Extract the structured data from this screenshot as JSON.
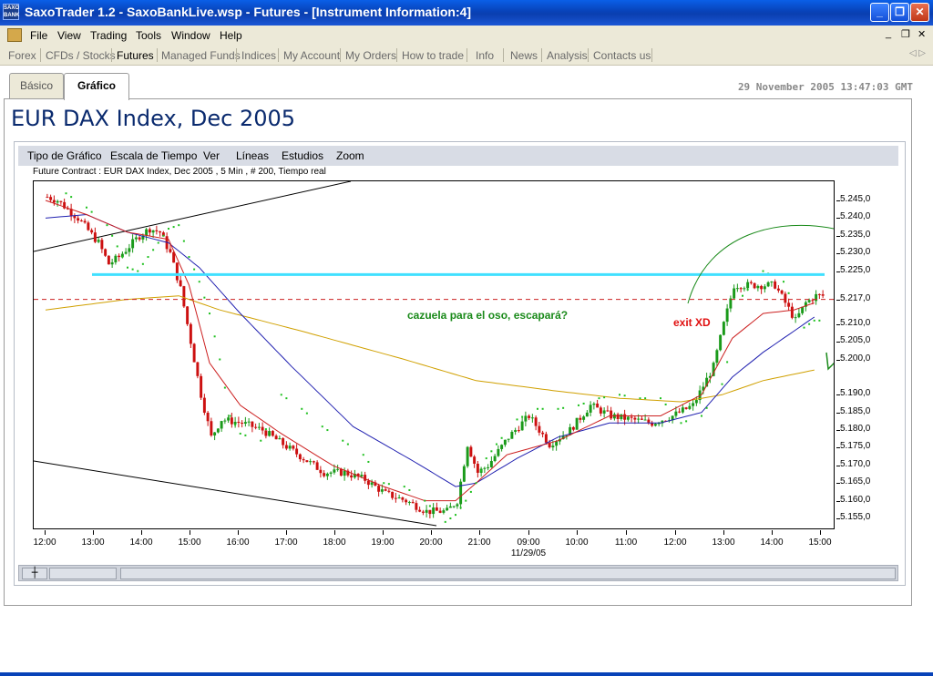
{
  "window": {
    "icon_text": "SAXO BANK",
    "title": "SaxoTrader 1.2 - SaxoBankLive.wsp - Futures - [Instrument Information:4]",
    "minimize": "_",
    "maximize": "❐",
    "close": "✕"
  },
  "menubar": {
    "items": [
      "File",
      "View",
      "Trading",
      "Tools",
      "Window",
      "Help"
    ],
    "mdi_min": "_",
    "mdi_restore": "❐",
    "mdi_close": "✕"
  },
  "nav": {
    "tabs": [
      "Forex",
      "CFDs / Stocks",
      "Futures",
      "Managed Funds",
      "Indices",
      "My Account",
      "My Orders",
      "How to trade",
      "Info",
      "News",
      "Analysis",
      "Contacts us"
    ],
    "active": "Futures",
    "scroll": "◁ ▷"
  },
  "subtabs": {
    "basic": "Básico",
    "chart": "Gráfico",
    "active": "Gráfico"
  },
  "timestamp": "29 November 2005 13:47:03 GMT",
  "instrument_title": "EUR DAX Index, Dec 2005",
  "chart_toolbar": [
    "Tipo de Gráfico",
    "Escala de Tiempo",
    "Ver",
    "Líneas",
    "Estudios",
    "Zoom"
  ],
  "contract_info": "Future Contract : EUR DAX Index, Dec 2005 , 5 Min , # 200, Tiempo real",
  "annotations": {
    "pot": "cazuela para el oso, escapará?",
    "exit": "exit XD",
    "colors": {
      "pot": "#1a8a1a",
      "exit": "#e01010",
      "resistance": "#40e0ff",
      "ref_line": "#cc2020"
    }
  },
  "colors": {
    "up": "#1a9a1a",
    "down": "#cc1010",
    "sma_fast": "#cc2020",
    "sma_mid": "#2020b0",
    "sma_slow": "#d0a000",
    "psar": "#20c020",
    "trend": "#000000"
  },
  "chart_data": {
    "type": "candlestick",
    "interval": "5 Min",
    "x_labels": [
      "12:00",
      "13:00",
      "14:00",
      "15:00",
      "16:00",
      "17:00",
      "18:00",
      "19:00",
      "20:00",
      "21:00",
      "09:00",
      "10:00",
      "11:00",
      "12:00",
      "13:00",
      "14:00",
      "15:00"
    ],
    "date_label": "11/29/05",
    "y_labels": [
      "5.245,0",
      "5.240,0",
      "5.235,0",
      "5.230,0",
      "5.225,0",
      "5.217,0",
      "5.210,0",
      "5.205,0",
      "5.200,0",
      "5.190,0",
      "5.185,0",
      "5.180,0",
      "5.175,0",
      "5.170,0",
      "5.165,0",
      "5.160,0",
      "5.155,0"
    ],
    "y_values": [
      5245,
      5240,
      5235,
      5230,
      5225,
      5217,
      5210,
      5205,
      5200,
      5190,
      5185,
      5180,
      5175,
      5170,
      5165,
      5160,
      5155
    ],
    "ylim": [
      5152.5,
      5250
    ],
    "reference_price": 5217,
    "resistance_price": 5224,
    "close_path": [
      [
        0,
        5246
      ],
      [
        1,
        5245
      ],
      [
        3,
        5240
      ],
      [
        5,
        5233
      ],
      [
        6,
        5227
      ],
      [
        7,
        5229
      ],
      [
        9,
        5235
      ],
      [
        10,
        5237
      ],
      [
        11,
        5236
      ],
      [
        12,
        5230
      ],
      [
        13,
        5220
      ],
      [
        14,
        5205
      ],
      [
        15,
        5190
      ],
      [
        16,
        5178
      ],
      [
        17,
        5183
      ],
      [
        19,
        5182
      ],
      [
        21,
        5180
      ],
      [
        23,
        5176
      ],
      [
        25,
        5172
      ],
      [
        27,
        5168
      ],
      [
        29,
        5168
      ],
      [
        31,
        5166
      ],
      [
        33,
        5162
      ],
      [
        35,
        5160
      ],
      [
        37,
        5157
      ],
      [
        39,
        5157
      ],
      [
        40,
        5160
      ],
      [
        41,
        5176
      ],
      [
        42,
        5168
      ],
      [
        43,
        5170
      ],
      [
        45,
        5178
      ],
      [
        47,
        5184
      ],
      [
        49,
        5176
      ],
      [
        51,
        5180
      ],
      [
        53,
        5187
      ],
      [
        55,
        5184
      ],
      [
        57,
        5183
      ],
      [
        59,
        5182
      ],
      [
        61,
        5184
      ],
      [
        63,
        5187
      ],
      [
        65,
        5198
      ],
      [
        66,
        5210
      ],
      [
        67,
        5221
      ],
      [
        69,
        5221
      ],
      [
        71,
        5221
      ],
      [
        73,
        5211
      ],
      [
        74,
        5216
      ],
      [
        75,
        5218
      ]
    ],
    "sma_fast": [
      [
        0,
        5245
      ],
      [
        4,
        5241
      ],
      [
        8,
        5236
      ],
      [
        12,
        5234
      ],
      [
        14,
        5221
      ],
      [
        16,
        5199
      ],
      [
        19,
        5187
      ],
      [
        23,
        5179
      ],
      [
        28,
        5170
      ],
      [
        33,
        5164
      ],
      [
        37,
        5160
      ],
      [
        40,
        5160
      ],
      [
        42,
        5165
      ],
      [
        45,
        5173
      ],
      [
        50,
        5177
      ],
      [
        55,
        5184
      ],
      [
        60,
        5184
      ],
      [
        64,
        5190
      ],
      [
        67,
        5206
      ],
      [
        70,
        5213
      ],
      [
        73,
        5214
      ],
      [
        75,
        5216
      ]
    ],
    "sma_mid": [
      [
        0,
        5240
      ],
      [
        4,
        5241
      ],
      [
        8,
        5236
      ],
      [
        12,
        5233
      ],
      [
        15,
        5226
      ],
      [
        19,
        5213
      ],
      [
        24,
        5198
      ],
      [
        30,
        5181
      ],
      [
        36,
        5171
      ],
      [
        40,
        5164
      ],
      [
        42,
        5165
      ],
      [
        46,
        5172
      ],
      [
        50,
        5178
      ],
      [
        55,
        5182
      ],
      [
        60,
        5182
      ],
      [
        64,
        5185
      ],
      [
        67,
        5195
      ],
      [
        70,
        5202
      ],
      [
        73,
        5208
      ],
      [
        75,
        5212
      ]
    ],
    "sma_slow": [
      [
        0,
        5214
      ],
      [
        8,
        5217
      ],
      [
        13,
        5218
      ],
      [
        17,
        5214
      ],
      [
        25,
        5208
      ],
      [
        35,
        5200
      ],
      [
        42,
        5194
      ],
      [
        50,
        5191
      ],
      [
        56,
        5189
      ],
      [
        62,
        5188
      ],
      [
        66,
        5190
      ],
      [
        70,
        5194
      ],
      [
        75,
        5197
      ]
    ],
    "psar_points": [
      [
        2,
        5247
      ],
      [
        4,
        5243
      ],
      [
        6,
        5238
      ],
      [
        7,
        5232
      ],
      [
        8,
        5226
      ],
      [
        9,
        5225
      ],
      [
        10,
        5229
      ],
      [
        11,
        5233
      ],
      [
        12,
        5237
      ],
      [
        13,
        5238
      ],
      [
        14,
        5229
      ],
      [
        15,
        5222
      ],
      [
        16,
        5213
      ],
      [
        17,
        5200
      ],
      [
        18,
        5184
      ],
      [
        19,
        5179
      ],
      [
        21,
        5177
      ],
      [
        23,
        5190
      ],
      [
        25,
        5186
      ],
      [
        27,
        5181
      ],
      [
        29,
        5177
      ],
      [
        31,
        5173
      ],
      [
        33,
        5165
      ],
      [
        35,
        5164
      ],
      [
        37,
        5160
      ],
      [
        39,
        5154
      ],
      [
        40,
        5156
      ],
      [
        41,
        5160
      ],
      [
        42,
        5165
      ],
      [
        43,
        5172
      ],
      [
        44,
        5176
      ],
      [
        46,
        5183
      ],
      [
        48,
        5186
      ],
      [
        50,
        5186
      ],
      [
        52,
        5187
      ],
      [
        54,
        5189
      ],
      [
        56,
        5190
      ],
      [
        58,
        5189
      ],
      [
        60,
        5189
      ],
      [
        62,
        5182
      ],
      [
        64,
        5184
      ],
      [
        66,
        5193
      ],
      [
        68,
        5218
      ],
      [
        70,
        5225
      ],
      [
        72,
        5222
      ],
      [
        74,
        5209
      ],
      [
        75,
        5211
      ]
    ]
  }
}
